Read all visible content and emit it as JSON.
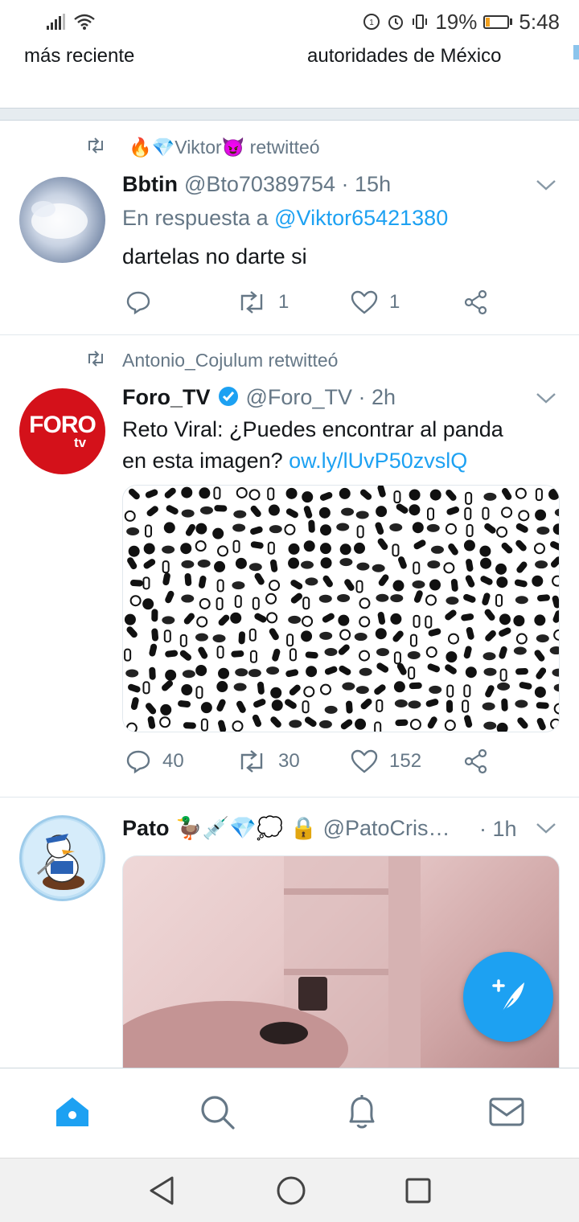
{
  "status_bar": {
    "battery": "19%",
    "battery_level": 0.19,
    "time": "5:48",
    "battery_color": "#f2a01e"
  },
  "top_strip": {
    "left_text": "más reciente",
    "right_text": "autoridades de México"
  },
  "tweets": [
    {
      "retweeted_by": "🔥💎Viktor😈 retwitteó",
      "name": "Bbtin",
      "handle": "@Bto70389754 · 15h",
      "reply_prefix": "En respuesta a",
      "reply_handle": "@Viktor65421380",
      "text": "dartelas  no darte si",
      "retweets": "1",
      "likes": "1"
    },
    {
      "retweeted_by": "Antonio_Cojulum retwitteó",
      "name": "Foro_TV",
      "handle": "@Foro_TV · 2h",
      "text_line1": "Reto Viral: ¿Puedes encontrar al panda",
      "text_line2": "en esta imagen?",
      "link": "ow.ly/lUvP50zvslQ",
      "avatar_logo": "FORO",
      "avatar_sub": "tv",
      "replies": "40",
      "retweets": "30",
      "likes": "152"
    },
    {
      "name": "Pato 🦆💉💎💭",
      "handle": "🔒 @PatoCris…",
      "time": "· 1h"
    }
  ],
  "colors": {
    "accent": "#1da1f2",
    "secondary_text": "#657786",
    "foro_red": "#d4111a"
  },
  "icons": {
    "tab_home": "home-icon",
    "tab_search": "search-icon",
    "tab_notifications": "bell-icon",
    "tab_messages": "mail-icon",
    "fab": "compose-tweet-icon"
  }
}
